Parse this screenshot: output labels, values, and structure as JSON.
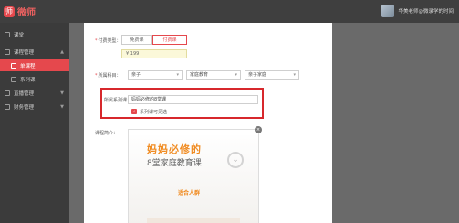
{
  "app": {
    "logo_text": "微师",
    "logo_glyph": "师"
  },
  "user": {
    "name": "华美老师@微录学的时间"
  },
  "sidebar": {
    "items": [
      {
        "label": "课堂",
        "icon": "home-icon"
      },
      {
        "label": "课程管理",
        "icon": "book-icon",
        "chevron": "▲"
      },
      {
        "label": "单课程",
        "icon": "lesson-icon",
        "active": true
      },
      {
        "label": "系列课",
        "icon": "series-icon"
      },
      {
        "label": "直播管理",
        "icon": "live-icon",
        "chevron": "▼"
      },
      {
        "label": "财务管理",
        "icon": "finance-icon",
        "chevron": "▼"
      }
    ]
  },
  "form": {
    "pricing_label": "付费类型：",
    "pricing_options": [
      "免费课",
      "付费课"
    ],
    "pricing_selected": "付费课",
    "price_value": "¥  199",
    "category_label": "所属科目：",
    "category_selects": [
      {
        "value": "亲子"
      },
      {
        "value": "家庭教育"
      },
      {
        "value": "亲子家庭"
      }
    ],
    "series_label": "所属系列课：",
    "series_value": "妈妈必修的8堂课",
    "series_visible_label": "系列课可见选",
    "series_visible_checked": true,
    "intro_label": "课程简介："
  },
  "editor": {
    "close_glyph": "×",
    "banner_line1": "妈妈必修的",
    "banner_line2": "8堂家庭教育课",
    "banner_line3": "适合人群",
    "arrow_glyph": "⌄"
  },
  "colors": {
    "accent": "#e5484d",
    "highlight": "#d7282c",
    "banner_orange": "#f08a1f"
  }
}
